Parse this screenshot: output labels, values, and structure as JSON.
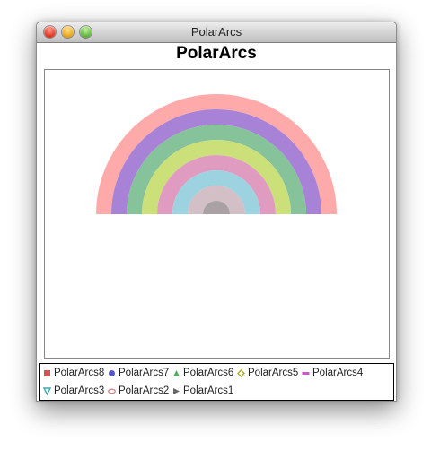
{
  "window": {
    "title": "PolarArcs"
  },
  "chart_data": {
    "type": "polar-arcs",
    "title": "PolarArcs",
    "series": [
      {
        "name": "PolarArcs8",
        "color": "#ffaaaa",
        "marker": "square"
      },
      {
        "name": "PolarArcs7",
        "color": "#a882d6",
        "marker": "circle"
      },
      {
        "name": "PolarArcs6",
        "color": "#86c29a",
        "marker": "triangle-up"
      },
      {
        "name": "PolarArcs5",
        "color": "#cce079",
        "marker": "diamond"
      },
      {
        "name": "PolarArcs4",
        "color": "#e09cc0",
        "marker": "dash"
      },
      {
        "name": "PolarArcs3",
        "color": "#9dd2e0",
        "marker": "triangle-down"
      },
      {
        "name": "PolarArcs2",
        "color": "#d2c0c6",
        "marker": "ellipse"
      },
      {
        "name": "PolarArcs1",
        "color": "#a9a1a3",
        "marker": "triangle-right"
      }
    ],
    "legend_position": "bottom",
    "grid": false
  }
}
